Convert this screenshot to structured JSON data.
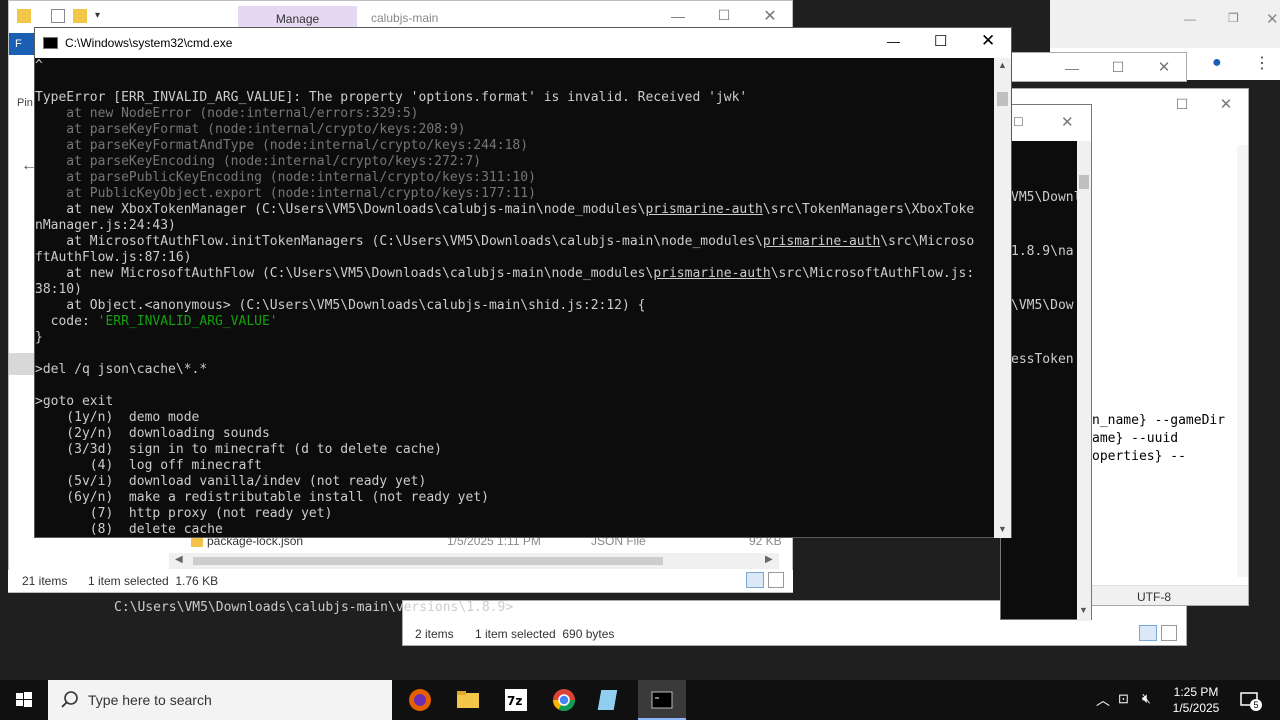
{
  "explorer": {
    "manage_tab": "Manage",
    "title": "calubjs-main",
    "ribbon_letter": "F",
    "left_nav_pin": "Pin",
    "status_count": "21 items",
    "status_selected": "1 item selected  1.76 KB",
    "hidden_file_name": "package-lock.json",
    "hidden_file_date": "1/5/2025 1:11 PM",
    "hidden_file_type": "JSON File",
    "hidden_file_size": "92 KB"
  },
  "explorer2": {
    "status_count": "2 items",
    "status_selected": "1 item selected  690 bytes"
  },
  "notepad": {
    "lines": [
      "n_name} --gameDir",
      "ame} --uuid",
      "operties} --"
    ],
    "encoding": "UTF-8"
  },
  "console2": {
    "lines": [
      "VM5\\Downl",
      "1.8.9\\na",
      "\\VM5\\Dow",
      "essToken"
    ]
  },
  "cmd": {
    "title": "C:\\Windows\\system32\\cmd.exe",
    "lines": [
      {
        "t": "^",
        "c": ""
      },
      {
        "t": "",
        "c": ""
      },
      {
        "t": "TypeError [ERR_INVALID_ARG_VALUE]: The property 'options.format' is invalid. Received 'jwk'",
        "c": ""
      },
      {
        "t": "    at new NodeError (node:internal/errors:329:5)",
        "c": "dim"
      },
      {
        "t": "    at parseKeyFormat (node:internal/crypto/keys:208:9)",
        "c": "dim"
      },
      {
        "t": "    at parseKeyFormatAndType (node:internal/crypto/keys:244:18)",
        "c": "dim"
      },
      {
        "t": "    at parseKeyEncoding (node:internal/crypto/keys:272:7)",
        "c": "dim"
      },
      {
        "t": "    at parsePublicKeyEncoding (node:internal/crypto/keys:311:10)",
        "c": "dim"
      },
      {
        "t": "    at PublicKeyObject.export (node:internal/crypto/keys:177:11)",
        "c": "dim"
      },
      {
        "t": "    at new XboxTokenManager (C:\\Users\\VM5\\Downloads\\calubjs-main\\node_modules\\prismarine-auth\\src\\TokenManagers\\XboxToke",
        "c": ""
      },
      {
        "t": "nManager.js:24:43)",
        "c": ""
      },
      {
        "t": "    at MicrosoftAuthFlow.initTokenManagers (C:\\Users\\VM5\\Downloads\\calubjs-main\\node_modules\\prismarine-auth\\src\\Microso",
        "c": ""
      },
      {
        "t": "ftAuthFlow.js:87:16)",
        "c": ""
      },
      {
        "t": "    at new MicrosoftAuthFlow (C:\\Users\\VM5\\Downloads\\calubjs-main\\node_modules\\prismarine-auth\\src\\MicrosoftAuthFlow.js:",
        "c": ""
      },
      {
        "t": "38:10)",
        "c": ""
      },
      {
        "t": "    at Object.<anonymous> (C:\\Users\\VM5\\Downloads\\calubjs-main\\shid.js:2:12) {",
        "c": ""
      },
      {
        "t": "  code: 'ERR_INVALID_ARG_VALUE'",
        "c": "code"
      },
      {
        "t": "}",
        "c": ""
      },
      {
        "t": "",
        "c": ""
      },
      {
        "t": ">del /q json\\cache\\*.*",
        "c": ""
      },
      {
        "t": "",
        "c": ""
      },
      {
        "t": ">goto exit",
        "c": ""
      },
      {
        "t": "    (1y/n)  demo mode",
        "c": ""
      },
      {
        "t": "    (2y/n)  downloading sounds",
        "c": ""
      },
      {
        "t": "    (3/3d)  sign in to minecraft (d to delete cache)",
        "c": ""
      },
      {
        "t": "       (4)  log off minecraft",
        "c": ""
      },
      {
        "t": "    (5v/i)  download vanilla/indev (not ready yet)",
        "c": ""
      },
      {
        "t": "    (6y/n)  make a redistributable install (not ready yet)",
        "c": ""
      },
      {
        "t": "       (7)  http proxy (not ready yet)",
        "c": ""
      },
      {
        "t": "       (8)  delete cache",
        "c": ""
      }
    ]
  },
  "prompt_path": "C:\\Users\\VM5\\Downloads\\calubjs-main\\versions\\1.8.9>",
  "taskbar": {
    "search_placeholder": "Type here to search",
    "time": "1:25 PM",
    "date": "1/5/2025",
    "notification_count": "5"
  },
  "colors": {
    "console_bg": "#0c0c0c",
    "console_fg": "#cccccc",
    "dim_fg": "#767676",
    "green": "#13a10e",
    "manage_tab": "#e6d7f2"
  }
}
